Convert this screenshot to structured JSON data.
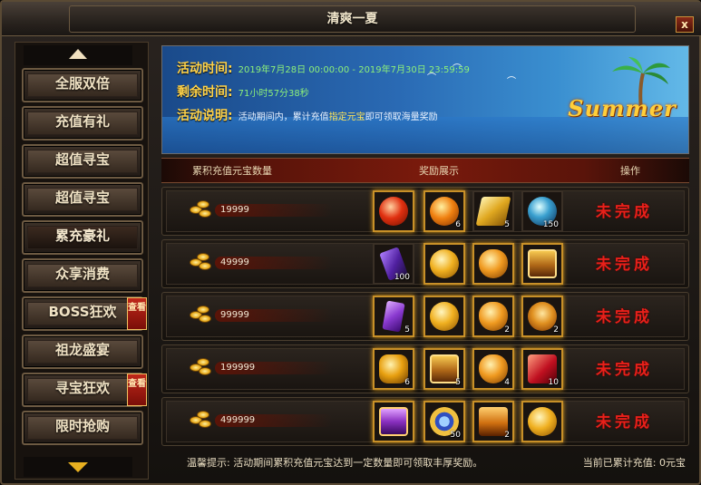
{
  "window": {
    "title": "清爽一夏",
    "close_label": "x"
  },
  "sidebar": {
    "items": [
      {
        "label": "全服双倍",
        "badge": ""
      },
      {
        "label": "充值有礼",
        "badge": ""
      },
      {
        "label": "超值寻宝",
        "badge": ""
      },
      {
        "label": "超值寻宝",
        "badge": ""
      },
      {
        "label": "累充豪礼",
        "badge": "",
        "active": true
      },
      {
        "label": "众享消费",
        "badge": ""
      },
      {
        "label": "BOSS狂欢",
        "badge": "查看"
      },
      {
        "label": "祖龙盛宴",
        "badge": ""
      },
      {
        "label": "寻宝狂欢",
        "badge": "查看"
      },
      {
        "label": "限时抢购",
        "badge": ""
      }
    ]
  },
  "banner": {
    "time_label": "活动时间:",
    "time_value": "2019年7月28日 00:00:00 - 2019年7月30日 23:59:59",
    "remain_label": "剩余时间:",
    "remain_value": "71小时57分38秒",
    "desc_label": "活动说明:",
    "desc_pre": "活动期间内，累计充值",
    "desc_hl": "指定元宝",
    "desc_post": "即可领取海量奖励",
    "logo_text": "Summer"
  },
  "table": {
    "col_amount": "累积充值元宝数量",
    "col_rewards": "奖励展示",
    "col_action": "操作",
    "rows": [
      {
        "amount": "19999",
        "status": "未完成",
        "rewards": [
          {
            "icon": "red-orb",
            "qty": "",
            "glow": true
          },
          {
            "icon": "fire-orb",
            "qty": "6",
            "glow": true
          },
          {
            "icon": "gold-bar",
            "qty": "5",
            "glow": false
          },
          {
            "icon": "blue-orb",
            "qty": "150",
            "glow": false
          }
        ]
      },
      {
        "amount": "49999",
        "status": "未完成",
        "rewards": [
          {
            "icon": "purple-token",
            "qty": "100",
            "glow": false
          },
          {
            "icon": "gold-ball",
            "qty": "",
            "glow": true
          },
          {
            "icon": "gold-egg",
            "qty": "",
            "glow": true
          },
          {
            "icon": "gold-chest",
            "qty": "",
            "glow": true
          }
        ]
      },
      {
        "amount": "99999",
        "status": "未完成",
        "rewards": [
          {
            "icon": "purple-crystal",
            "qty": "5",
            "glow": true
          },
          {
            "icon": "gold-ball",
            "qty": "",
            "glow": true
          },
          {
            "icon": "gold-egg",
            "qty": "2",
            "glow": true
          },
          {
            "icon": "fire-crown",
            "qty": "2",
            "glow": true
          }
        ]
      },
      {
        "amount": "199999",
        "status": "未完成",
        "rewards": [
          {
            "icon": "gold-claw",
            "qty": "6",
            "glow": true
          },
          {
            "icon": "gold-chest",
            "qty": "5",
            "glow": true
          },
          {
            "icon": "gold-egg",
            "qty": "4",
            "glow": true
          },
          {
            "icon": "ruby-box",
            "qty": "10",
            "glow": true
          }
        ]
      },
      {
        "amount": "499999",
        "status": "未完成",
        "rewards": [
          {
            "icon": "purple-chest",
            "qty": "",
            "glow": true
          },
          {
            "icon": "blue-amulet",
            "qty": "50",
            "glow": true
          },
          {
            "icon": "flame-chest",
            "qty": "2",
            "glow": true
          },
          {
            "icon": "gold-ball",
            "qty": "",
            "glow": true
          }
        ]
      }
    ]
  },
  "footer": {
    "tip": "温馨提示: 活动期间累积充值元宝达到一定数量即可领取丰厚奖励。",
    "total": "当前已累计充值: 0元宝"
  },
  "colors": {
    "accent_gold": "#e8b020",
    "status_red": "#e8201a",
    "banner_green": "#7ff06a",
    "banner_label": "#ffd34a"
  }
}
